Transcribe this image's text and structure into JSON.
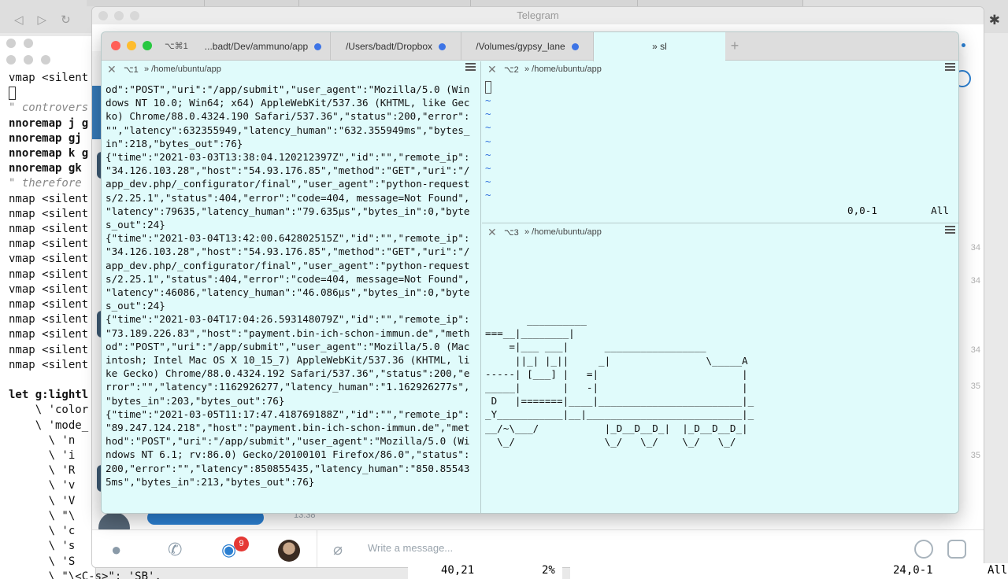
{
  "browser": {
    "nav": {
      "back": "◁",
      "forward": "▷",
      "reload": "↻"
    },
    "extensions_icon": "puzzle-icon"
  },
  "vim_back": {
    "lines": [
      {
        "text": "vmap <silent",
        "style": ""
      },
      {
        "text": "",
        "style": "cursor"
      },
      {
        "text": "\" controvers",
        "style": "c"
      },
      {
        "text": "nnoremap j g",
        "style": "k"
      },
      {
        "text": "nnoremap gj ",
        "style": "k"
      },
      {
        "text": "nnoremap k g",
        "style": "k"
      },
      {
        "text": "nnoremap gk ",
        "style": "k"
      },
      {
        "text": "\" therefore",
        "style": "c"
      },
      {
        "text": "nmap <silent",
        "style": ""
      },
      {
        "text": "nmap <silent",
        "style": ""
      },
      {
        "text": "nmap <silent",
        "style": ""
      },
      {
        "text": "nmap <silent",
        "style": ""
      },
      {
        "text": "vmap <silent",
        "style": ""
      },
      {
        "text": "nmap <silent",
        "style": ""
      },
      {
        "text": "vmap <silent",
        "style": ""
      },
      {
        "text": "nmap <silent",
        "style": ""
      },
      {
        "text": "nmap <silent",
        "style": ""
      },
      {
        "text": "nmap <silent",
        "style": ""
      },
      {
        "text": "nmap <silent",
        "style": ""
      },
      {
        "text": "nmap <silent",
        "style": ""
      },
      {
        "text": "",
        "style": ""
      },
      {
        "text": "let g:lightl",
        "style": "k"
      },
      {
        "text": "    \\ 'color",
        "style": ""
      },
      {
        "text": "    \\ 'mode_",
        "style": ""
      },
      {
        "text": "      \\ 'n",
        "style": ""
      },
      {
        "text": "      \\ 'i",
        "style": ""
      },
      {
        "text": "      \\ 'R",
        "style": ""
      },
      {
        "text": "      \\ 'v",
        "style": ""
      },
      {
        "text": "      \\ 'V",
        "style": ""
      },
      {
        "text": "      \\ \"\\",
        "style": ""
      },
      {
        "text": "      \\ 'c",
        "style": ""
      },
      {
        "text": "      \\ 's",
        "style": ""
      },
      {
        "text": "      \\ 'S",
        "style": ""
      },
      {
        "text": "      \\ \"\\<C-s>\": 'SB',",
        "style": ""
      }
    ]
  },
  "telegram": {
    "title": "Telegram",
    "write_placeholder": "Write a message...",
    "chats_badge": "9",
    "chat_time": "13:38",
    "side_numbers": [
      "34",
      "34",
      "34",
      "35",
      "35"
    ]
  },
  "vim_status": {
    "left_pos": "40,21",
    "left_pct": "2%",
    "right_pos": "24,0-1",
    "right_pct": "All"
  },
  "iterm": {
    "shortcut": "⌥⌘1",
    "tabs": [
      {
        "label": "...badt/Dev/ammuno/app",
        "dot": true
      },
      {
        "label": "/Users/badt/Dropbox",
        "dot": true
      },
      {
        "label": "/Volumes/gypsy_lane",
        "dot": true
      },
      {
        "label": "» sl",
        "dot": false
      }
    ],
    "new_tab": "+",
    "colors": {
      "pane_bg": "#e0fbfb",
      "tilde": "#2f6fdc",
      "tab_dot": "#3d74e6",
      "red": "#ff5f57",
      "yellow": "#febc2e",
      "green": "#28c840"
    },
    "pane1": {
      "num": "⌥1",
      "path": "» /home/ubuntu/app",
      "log_lines": [
        "od\":\"POST\",\"uri\":\"/app/submit\",\"user_agent\":\"Mozilla/5.0 (Win",
        "dows NT 10.0; Win64; x64) AppleWebKit/537.36 (KHTML, like Gec",
        "ko) Chrome/88.0.4324.190 Safari/537.36\",\"status\":200,\"error\":",
        "\"\",\"latency\":632355949,\"latency_human\":\"632.355949ms\",\"bytes_",
        "in\":218,\"bytes_out\":76}",
        "{\"time\":\"2021-03-03T13:38:04.120212397Z\",\"id\":\"\",\"remote_ip\":",
        "\"34.126.103.28\",\"host\":\"54.93.176.85\",\"method\":\"GET\",\"uri\":\"/",
        "app_dev.php/_configurator/final\",\"user_agent\":\"python-request",
        "s/2.25.1\",\"status\":404,\"error\":\"code=404, message=Not Found\",",
        "\"latency\":79635,\"latency_human\":\"79.635µs\",\"bytes_in\":0,\"byte",
        "s_out\":24}",
        "{\"time\":\"2021-03-04T13:42:00.642802515Z\",\"id\":\"\",\"remote_ip\":",
        "\"34.126.103.28\",\"host\":\"54.93.176.85\",\"method\":\"GET\",\"uri\":\"/",
        "app_dev.php/_configurator/final\",\"user_agent\":\"python-request",
        "s/2.25.1\",\"status\":404,\"error\":\"code=404, message=Not Found\",",
        "\"latency\":46086,\"latency_human\":\"46.086µs\",\"bytes_in\":0,\"byte",
        "s_out\":24}",
        "{\"time\":\"2021-03-04T17:04:26.593148079Z\",\"id\":\"\",\"remote_ip\":",
        "\"73.189.226.83\",\"host\":\"payment.bin-ich-schon-immun.de\",\"meth",
        "od\":\"POST\",\"uri\":\"/app/submit\",\"user_agent\":\"Mozilla/5.0 (Mac",
        "intosh; Intel Mac OS X 10_15_7) AppleWebKit/537.36 (KHTML, li",
        "ke Gecko) Chrome/88.0.4324.192 Safari/537.36\",\"status\":200,\"e",
        "rror\":\"\",\"latency\":1162926277,\"latency_human\":\"1.162926277s\",",
        "\"bytes_in\":203,\"bytes_out\":76}",
        "{\"time\":\"2021-03-05T11:17:47.418769188Z\",\"id\":\"\",\"remote_ip\":",
        "\"89.247.124.218\",\"host\":\"payment.bin-ich-schon-immun.de\",\"met",
        "hod\":\"POST\",\"uri\":\"/app/submit\",\"user_agent\":\"Mozilla/5.0 (Wi",
        "ndows NT 6.1; rv:86.0) Gecko/20100101 Firefox/86.0\",\"status\":",
        "200,\"error\":\"\",\"latency\":850855435,\"latency_human\":\"850.85543",
        "5ms\",\"bytes_in\":213,\"bytes_out\":76}"
      ]
    },
    "pane2": {
      "num": "⌥2",
      "path": "» /home/ubuntu/app",
      "tildes": [
        "~",
        "~",
        "~",
        "~",
        "~",
        "~",
        "~",
        "~"
      ],
      "status": "0,0-1         All"
    },
    "pane3": {
      "num": "⌥3",
      "path": "» /home/ubuntu/app",
      "train_lines": [
        "       __________",
        "===__|________|",
        "    =|___ ___|      _________________",
        "     ||_| |_||     _|                \\_____A",
        "-----| [___] |   =|                        |",
        "_____|       |   -|                        |",
        " D   |=======|____|________________________|_",
        "_Y___________|__|__________________________|_",
        "__/~\\___/           |_D__D__D_|  |_D__D__D_|",
        "  \\_/               \\_/   \\_/    \\_/   \\_/"
      ]
    }
  }
}
